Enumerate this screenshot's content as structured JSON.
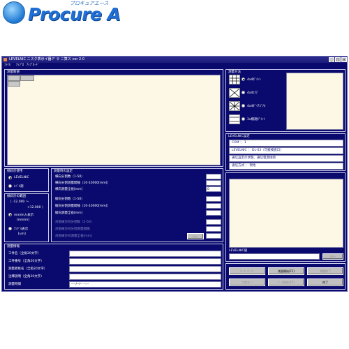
{
  "brand": {
    "name": "Procure A",
    "tagline": "プロキュアエース"
  },
  "window": {
    "title": "LEVELNIC ニスク表示イ器ア ラ ニ算ス ver 2.0",
    "controls": [
      "_",
      "□",
      "×"
    ]
  },
  "menu": [
    "ﾌｧｲﾙ",
    "ｱｯﾌﾟﾛ",
    "ｱｯﾌﾟﾛｰﾄﾞ"
  ],
  "measure_data": {
    "label": "測量数値"
  },
  "measure_method": {
    "label": "測量方法",
    "options": [
      {
        "label": "4x4ﾎﾟｲﾝﾄ",
        "selected": true
      },
      {
        "label": "4x4ｴﾘｱ",
        "selected": false
      },
      {
        "label": "4x4ﾀﾞｲｱｺﾞﾅﾙ",
        "selected": false
      },
      {
        "label": "3x横測ﾎﾟｲﾝﾄ",
        "selected": false
      }
    ]
  },
  "device_settings": {
    "label": "LEVELNIC設定",
    "rows": [
      "COM ： 1",
      "LEVELNIC ： DL-S3（可搬検査口）",
      "通信設定の状態、通信電源接続",
      "通信方式 ： 現地"
    ]
  },
  "sensor": {
    "label": "傾斜計使用",
    "options": [
      {
        "label": "LEVELNIC",
        "selected": true
      },
      {
        "label": "ﾚﾍﾞﾙ測",
        "selected": false
      }
    ]
  },
  "range": {
    "label": "傾斜計の範囲",
    "min": "（ -12.000 ～",
    "max": "+12.000 ）",
    "options": [
      {
        "label": "mm/m入表示",
        "unit": "[mm/m]",
        "selected": true
      },
      {
        "label": "ｱﾝｸﾞﾙ表示",
        "unit": "[um]",
        "selected": false
      }
    ]
  },
  "measure_settings": {
    "label": "測量時の設定",
    "rows": [
      {
        "label": "横向分割数（1-50）",
        "value": "",
        "disabled": false
      },
      {
        "label": "横向分割測量間隔（10-10000[mm]）",
        "value": "",
        "disabled": false
      },
      {
        "label": "横向測量全長[mm]",
        "value": "0",
        "disabled": false
      },
      {
        "label": "縦向分割数（1-50）",
        "value": "",
        "disabled": false
      },
      {
        "label": "縦向分割測量間隔（10-10000[mm]）",
        "value": "",
        "disabled": false
      },
      {
        "label": "縦向測量全長[mm]",
        "value": "",
        "disabled": false
      },
      {
        "label": "対角線方向分割数（2-50）",
        "value": "",
        "disabled": true
      },
      {
        "label": "対角線方向分割測量間隔",
        "value": "",
        "disabled": true
      },
      {
        "label": "対角線方向測量全長[mm]",
        "value": "",
        "disabled": true
      }
    ],
    "button": "ﾒﾓﾘｰ"
  },
  "level_input": {
    "label": "LEVELNIC値",
    "button": "ﾒﾓﾘｰ"
  },
  "measure_info": {
    "label": "測量情報",
    "rows": [
      {
        "label": "工件名（全角20文字）",
        "value": ""
      },
      {
        "label": "工件番号（全角20文字）",
        "value": ""
      },
      {
        "label": "測量者姓名（全角20文字）",
        "value": ""
      },
      {
        "label": "注釋說明（全角20文字）",
        "value": ""
      },
      {
        "label": "測量時間",
        "value": "----/--/-- --:--"
      }
    ]
  },
  "actions": [
    {
      "label": "ｺﾞｰﾄﾞｺﾞｰﾌﾟ",
      "disabled": true
    },
    {
      "label": "測量開始(F2)",
      "disabled": false
    },
    {
      "label": "測量終了",
      "disabled": true
    },
    {
      "label": "工程ｺﾋﾟｰ",
      "disabled": true
    },
    {
      "label": "ﾃﾞｰﾀ保存(F5)",
      "disabled": true
    },
    {
      "label": "終了",
      "disabled": false
    }
  ]
}
